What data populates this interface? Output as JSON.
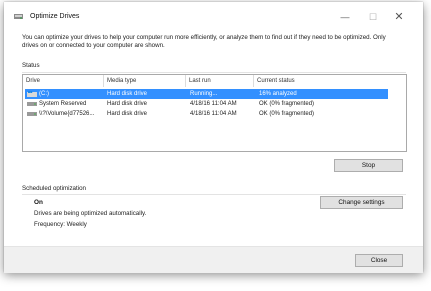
{
  "window": {
    "title": "Optimize Drives",
    "controls": {
      "minimize": "—",
      "maximize": "☐",
      "close": "✕"
    }
  },
  "description": "You can optimize your drives to help your computer run more efficiently, or analyze them to find out if they need to be optimized. Only drives on or connected to your computer are shown.",
  "status": {
    "label": "Status",
    "columns": [
      "Drive",
      "Media type",
      "Last run",
      "Current status"
    ],
    "rows": [
      {
        "drive": "(C:)",
        "media": "Hard disk drive",
        "last_run": "Running...",
        "status": "16% analyzed",
        "selected": true,
        "icon": "windows-drive-icon"
      },
      {
        "drive": "System Reserved",
        "media": "Hard disk drive",
        "last_run": "4/18/16 11:04 AM",
        "status": "OK (0% fragmented)",
        "selected": false,
        "icon": "hard-drive-icon"
      },
      {
        "drive": "\\\\?\\Volume{d77526...",
        "media": "Hard disk drive",
        "last_run": "4/18/16 11:04 AM",
        "status": "OK (0% fragmented)",
        "selected": false,
        "icon": "hard-drive-icon"
      }
    ],
    "stop_label": "Stop"
  },
  "scheduled": {
    "label": "Scheduled optimization",
    "state": "On",
    "description": "Drives are being optimized automatically.",
    "frequency": "Frequency: Weekly",
    "change_label": "Change settings"
  },
  "footer": {
    "close_label": "Close"
  },
  "colors": {
    "selection": "#3390ff",
    "button_face": "#e1e1e1"
  }
}
